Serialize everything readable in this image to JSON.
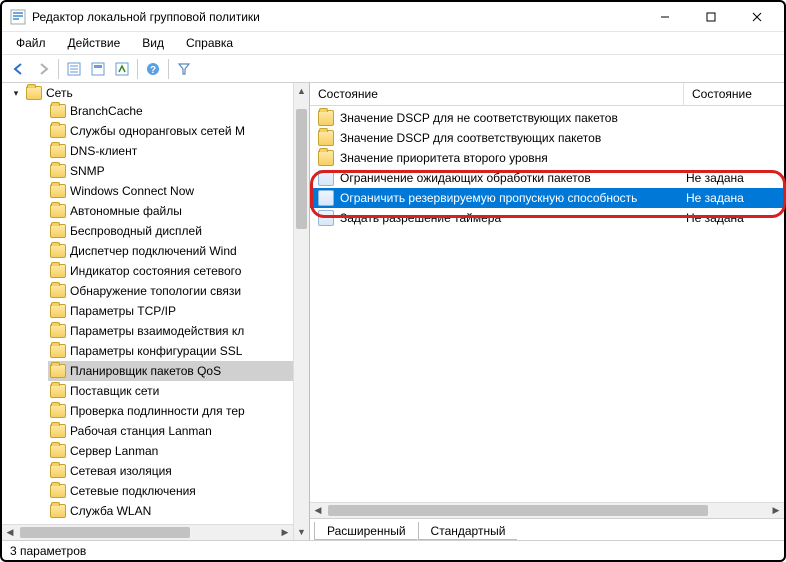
{
  "window": {
    "title": "Редактор локальной групповой политики"
  },
  "menu": {
    "file": "Файл",
    "action": "Действие",
    "view": "Вид",
    "help": "Справка"
  },
  "tree": {
    "root": "Сеть",
    "items": [
      {
        "label": "BranchCache",
        "expander": false
      },
      {
        "label": "Службы одноранговых сетей М",
        "expander": true
      },
      {
        "label": "DNS-клиент",
        "expander": false
      },
      {
        "label": "SNMP",
        "expander": false
      },
      {
        "label": "Windows Connect Now",
        "expander": false
      },
      {
        "label": "Автономные файлы",
        "expander": false
      },
      {
        "label": "Беспроводный дисплей",
        "expander": false
      },
      {
        "label": "Диспетчер подключений Wind",
        "expander": false
      },
      {
        "label": "Индикатор состояния сетевого",
        "expander": false
      },
      {
        "label": "Обнаружение топологии связи",
        "expander": false
      },
      {
        "label": "Параметры TCP/IP",
        "expander": true
      },
      {
        "label": "Параметры взаимодействия кл",
        "expander": false
      },
      {
        "label": "Параметры конфигурации SSL",
        "expander": false
      },
      {
        "label": "Планировщик пакетов QoS",
        "expander": false,
        "selected": true
      },
      {
        "label": "Поставщик сети",
        "expander": false
      },
      {
        "label": "Проверка подлинности для тер",
        "expander": false
      },
      {
        "label": "Рабочая станция Lanman",
        "expander": false
      },
      {
        "label": "Сервер Lanman",
        "expander": false
      },
      {
        "label": "Сетевая изоляция",
        "expander": false
      },
      {
        "label": "Сетевые подключения",
        "expander": false
      },
      {
        "label": "Служба WLAN",
        "expander": true
      }
    ]
  },
  "list": {
    "col_name": "Состояние",
    "col_state": "Состояние",
    "rows": [
      {
        "type": "folder",
        "label": "Значение DSCP для не соответствующих пакетов",
        "state": ""
      },
      {
        "type": "folder",
        "label": "Значение DSCP для соответствующих пакетов",
        "state": ""
      },
      {
        "type": "folder",
        "label": "Значение приоритета второго уровня",
        "state": ""
      },
      {
        "type": "policy",
        "label": "Ограничение ожидающих обработки пакетов",
        "state": "Не задана"
      },
      {
        "type": "policy",
        "label": "Ограничить резервируемую пропускную способность",
        "state": "Не задана",
        "selected": true
      },
      {
        "type": "policy",
        "label": "Задать разрешение таймера",
        "state": "Не задана"
      }
    ]
  },
  "tabs": {
    "extended": "Расширенный",
    "standard": "Стандартный"
  },
  "status": "3 параметров"
}
